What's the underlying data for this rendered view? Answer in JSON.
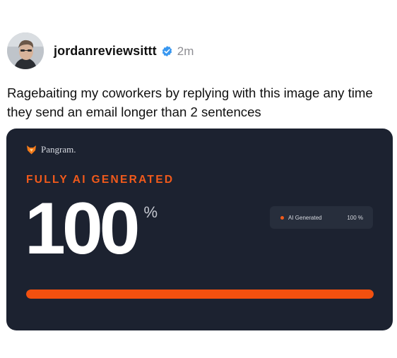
{
  "post": {
    "username": "jordanreviewsittt",
    "timestamp": "2m",
    "caption": "Ragebaiting my coworkers by replying with this image any time they send an email longer than 2 sentences"
  },
  "card": {
    "brand_name": "Pangram.",
    "verdict": "FULLY AI GENERATED",
    "score": "100",
    "score_unit": "%",
    "legend_label": "AI Generated",
    "legend_value": "100 %",
    "progress_fraction": 1.0
  },
  "icons": {
    "verified": "verified-badge-icon",
    "brand": "pangram-fox-logo-icon"
  },
  "colors": {
    "card_background": "#1c2230",
    "accent": "#f25a1b",
    "verified_blue": "#3897f0"
  }
}
